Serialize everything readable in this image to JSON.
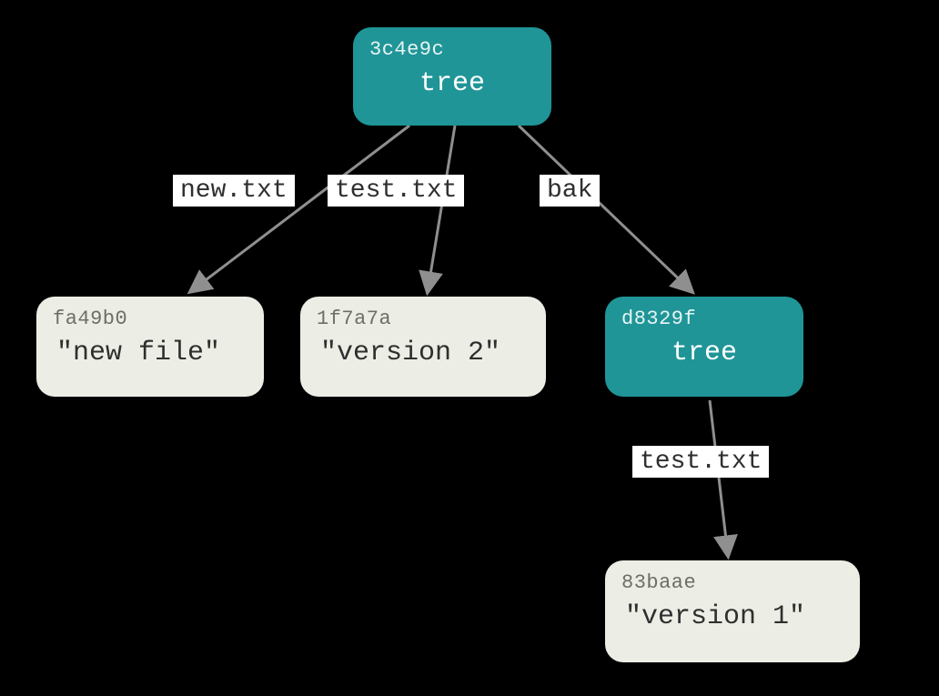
{
  "nodes": {
    "root": {
      "hash": "3c4e9c",
      "label": "tree",
      "type": "tree"
    },
    "new": {
      "hash": "fa49b0",
      "label": "\"new file\"",
      "type": "blob"
    },
    "v2": {
      "hash": "1f7a7a",
      "label": "\"version 2\"",
      "type": "blob"
    },
    "bak": {
      "hash": "d8329f",
      "label": "tree",
      "type": "tree"
    },
    "v1": {
      "hash": "83baae",
      "label": "\"version 1\"",
      "type": "blob"
    }
  },
  "edges": {
    "root_new": {
      "label": "new.txt"
    },
    "root_v2": {
      "label": "test.txt"
    },
    "root_bak": {
      "label": "bak"
    },
    "bak_v1": {
      "label": "test.txt"
    }
  }
}
